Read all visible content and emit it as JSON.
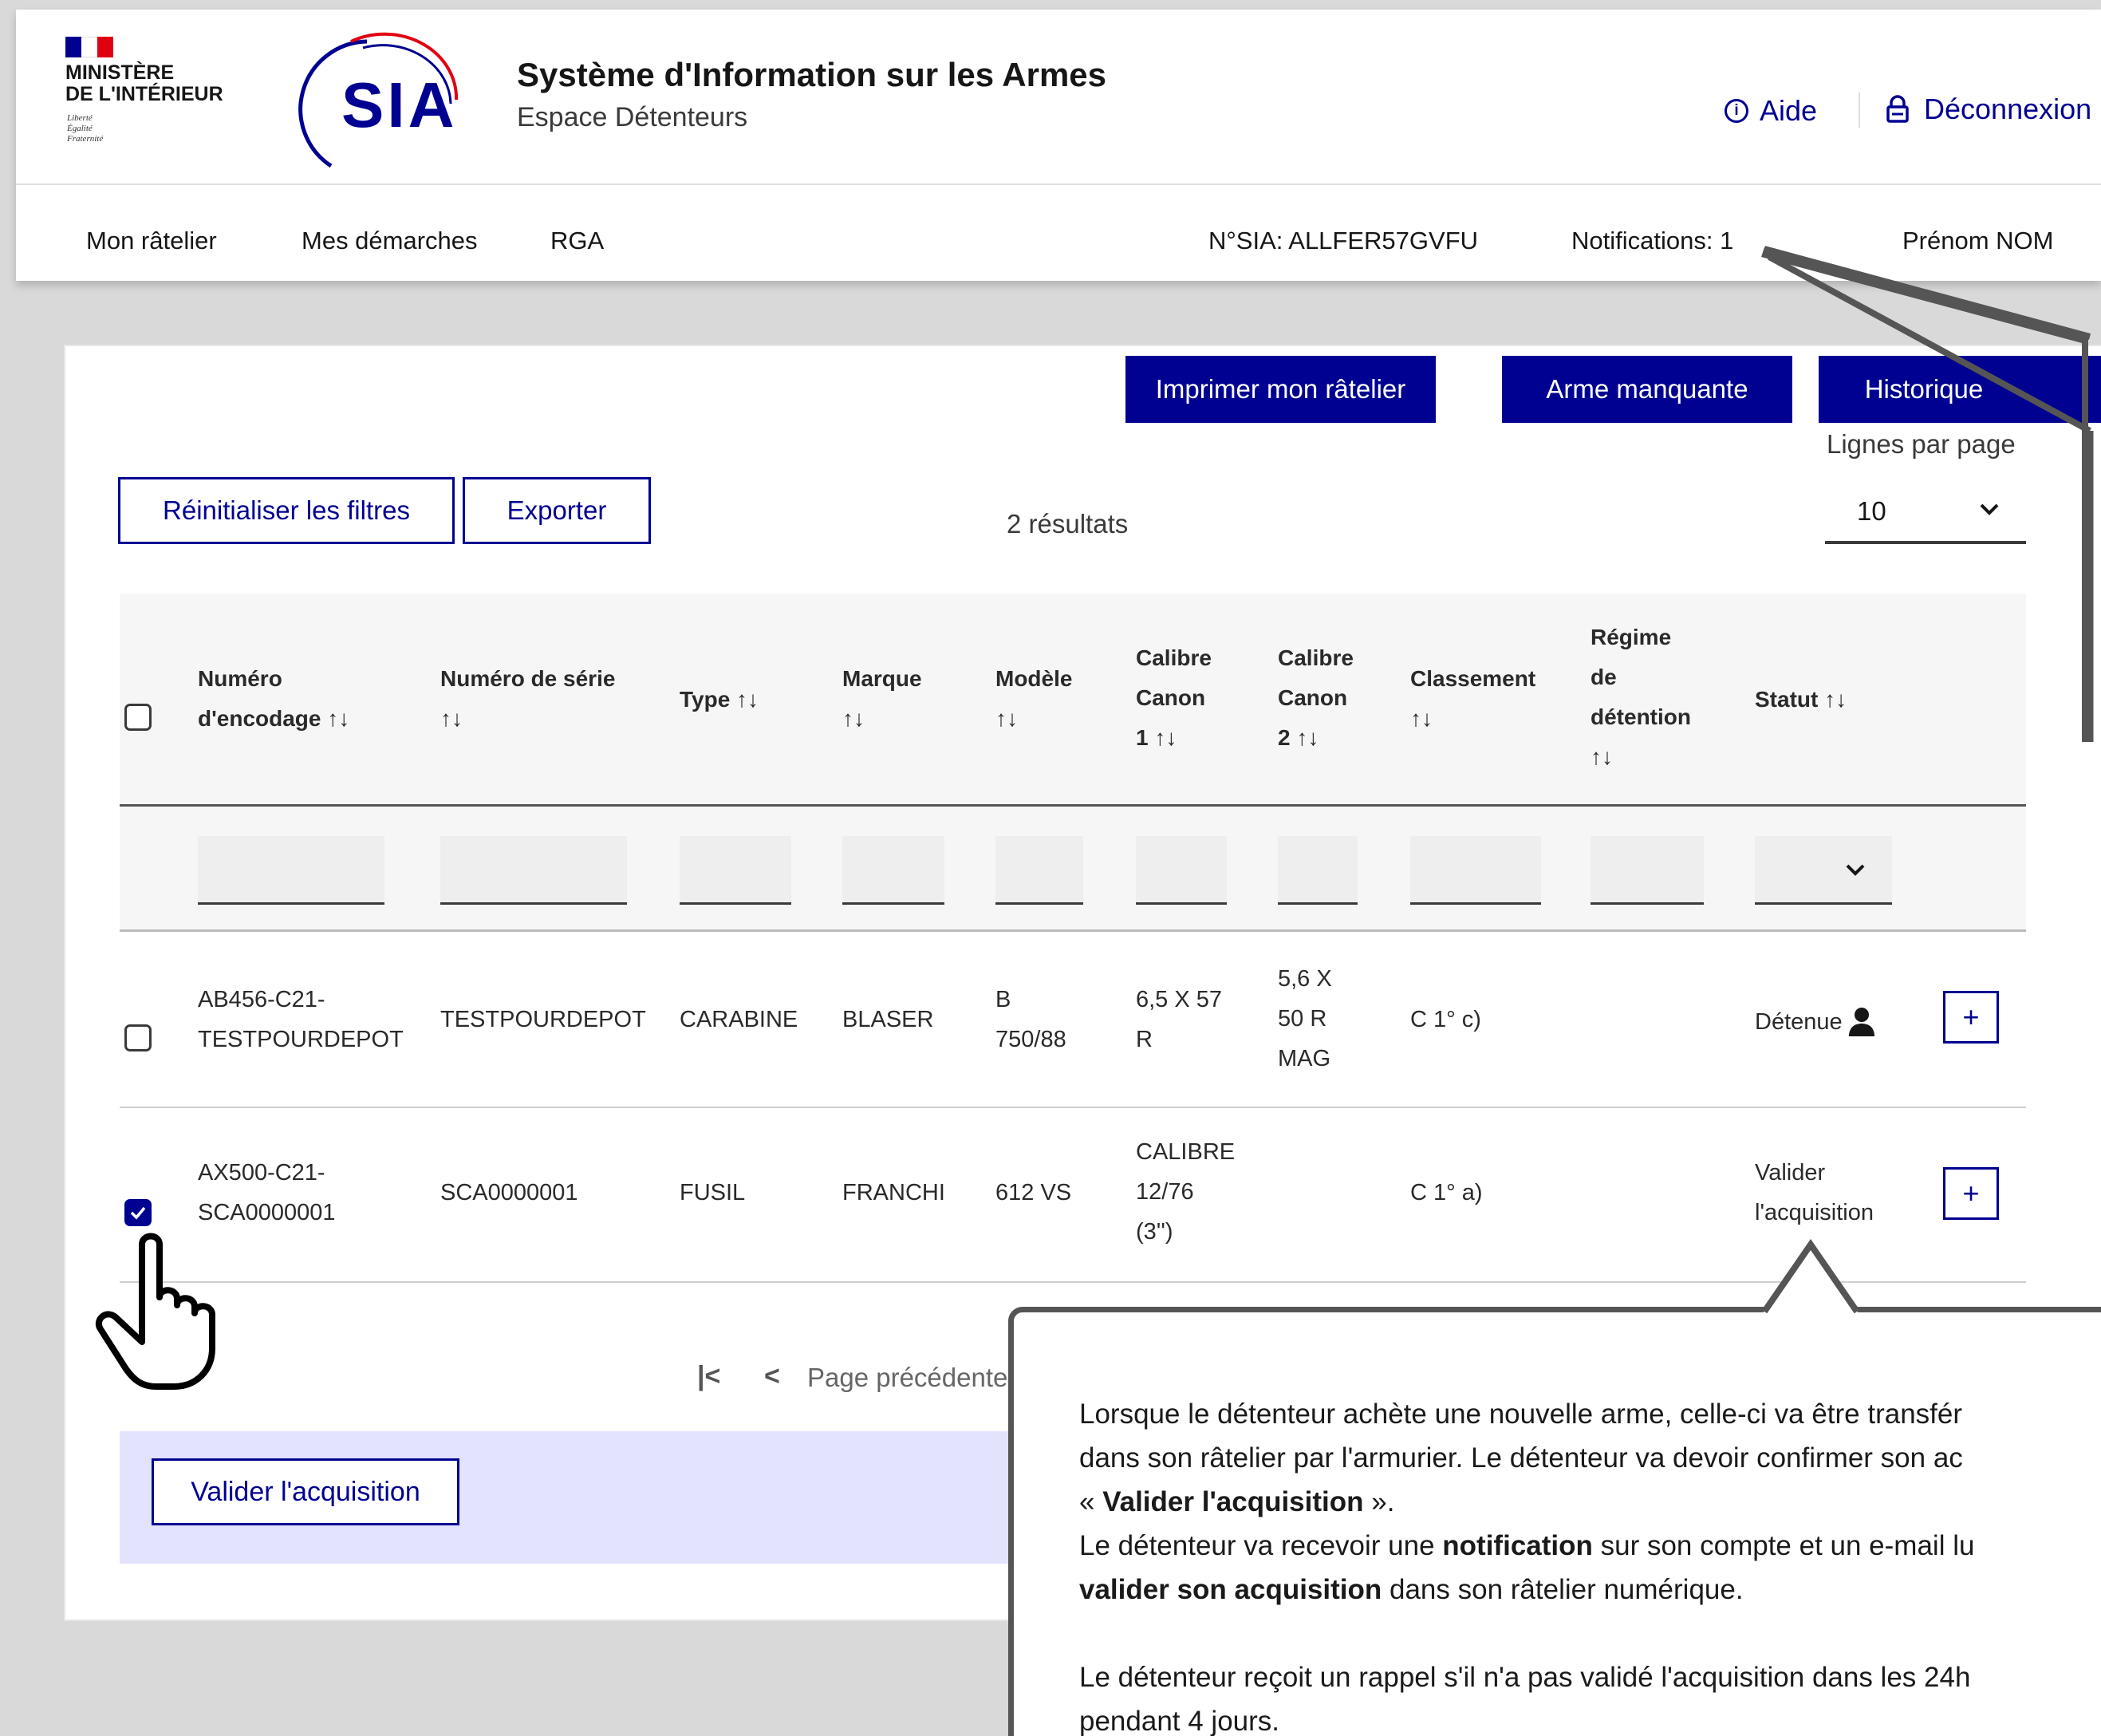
{
  "header": {
    "ministry_line1": "MINISTÈRE",
    "ministry_line2": "DE L'INTÉRIEUR",
    "motto": [
      "Liberté",
      "Égalité",
      "Fraternité"
    ],
    "sia_logo": "SIA",
    "app_title": "Système d'Information sur les Armes",
    "app_subtitle": "Espace Détenteurs",
    "help_label": "Aide",
    "logout_label": "Déconnexion"
  },
  "nav": {
    "items": [
      "Mon râtelier",
      "Mes démarches",
      "RGA"
    ],
    "sia_number": "N°SIA: ALLFER57GVFU",
    "notifications": "Notifications: 1",
    "user_name": "Prénom NOM"
  },
  "toolbar": {
    "print_label": "Imprimer mon râtelier",
    "missing_label": "Arme manquante",
    "history_label": "Historique",
    "reset_filters_label": "Réinitialiser les filtres",
    "export_label": "Exporter",
    "results_count": "2 résultats",
    "rows_per_page_label": "Lignes par page",
    "rows_per_page_value": "10"
  },
  "table": {
    "headers": {
      "encoding": [
        "Numéro",
        "d'encodage ↑↓"
      ],
      "serial": [
        "Numéro de série",
        "↑↓"
      ],
      "type": [
        "Type ↑↓"
      ],
      "brand": [
        "Marque",
        "↑↓"
      ],
      "model": [
        "Modèle",
        "↑↓"
      ],
      "cal1": [
        "Calibre",
        "Canon",
        "1 ↑↓"
      ],
      "cal2": [
        "Calibre",
        "Canon",
        "2 ↑↓"
      ],
      "class": [
        "Classement",
        "↑↓"
      ],
      "regime": [
        "Régime",
        "de",
        "détention",
        "↑↓"
      ],
      "status": [
        "Statut ↑↓"
      ]
    },
    "rows": [
      {
        "encoding": [
          "AB456-C21-",
          "TESTPOURDEPOT"
        ],
        "serial": "TESTPOURDEPOT",
        "type": "CARABINE",
        "brand": "BLASER",
        "model": [
          "B",
          "750/88"
        ],
        "cal1": [
          "6,5 X 57",
          "R"
        ],
        "cal2": [
          "5,6 X",
          "50 R",
          "MAG"
        ],
        "class": "C 1° c)",
        "regime": "",
        "status": "Détenue",
        "checked": false
      },
      {
        "encoding": [
          "AX500-C21-",
          "SCA0000001"
        ],
        "serial": "SCA0000001",
        "type": "FUSIL",
        "brand": "FRANCHI",
        "model": [
          "612 VS"
        ],
        "cal1": [
          "CALIBRE",
          "12/76",
          "(3'')"
        ],
        "cal2": [],
        "class": "C 1° a)",
        "regime": "",
        "status": [
          "Valider",
          "l'acquisition"
        ],
        "checked": true
      }
    ]
  },
  "pagination": {
    "first_label": "|<",
    "prev_label": "<",
    "prev_text": "Page précédente"
  },
  "action_bar": {
    "validate_label": "Valider l'acquisition"
  },
  "callout": {
    "line1": "Lorsque le détenteur achète une nouvelle arme, celle-ci va être transfér",
    "line2": "dans son râtelier par l'armurier. Le détenteur va devoir confirmer son ac",
    "line3_pre": "« ",
    "line3_bold": "Valider l'acquisition",
    "line3_post": " ».",
    "line4_pre": "Le détenteur va recevoir une ",
    "line4_bold": "notification",
    "line4_post": " sur son compte et un e-mail lu",
    "line5_bold": "valider son acquisition",
    "line5_post": " dans son râtelier numérique.",
    "line6": "Le détenteur reçoit un rappel s'il n'a pas validé l'acquisition dans les 24h",
    "line7": "pendant 4 jours."
  },
  "colors": {
    "primary_blue": "#000091",
    "flag_red": "#e1000f",
    "background": "#d9d9d9",
    "highlight_band": "#e3e3fd"
  }
}
